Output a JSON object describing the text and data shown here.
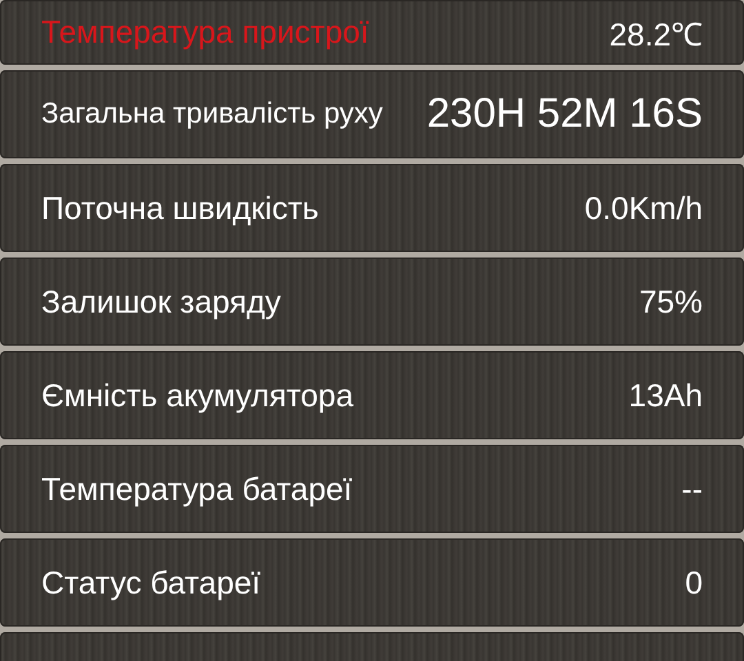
{
  "rows": [
    {
      "label": "Температура пристрої",
      "value": "28.2℃",
      "alert": true
    },
    {
      "label": "Загальна тривалість руху",
      "value": "230H 52M 16S",
      "alert": false
    },
    {
      "label": "Поточна швидкість",
      "value": "0.0Km/h",
      "alert": false
    },
    {
      "label": "Залишок заряду",
      "value": "75%",
      "alert": false
    },
    {
      "label": "Ємність акумулятора",
      "value": "13Ah",
      "alert": false
    },
    {
      "label": "Температура батареї",
      "value": "--",
      "alert": false
    },
    {
      "label": "Статус батареї",
      "value": "0",
      "alert": false
    }
  ]
}
